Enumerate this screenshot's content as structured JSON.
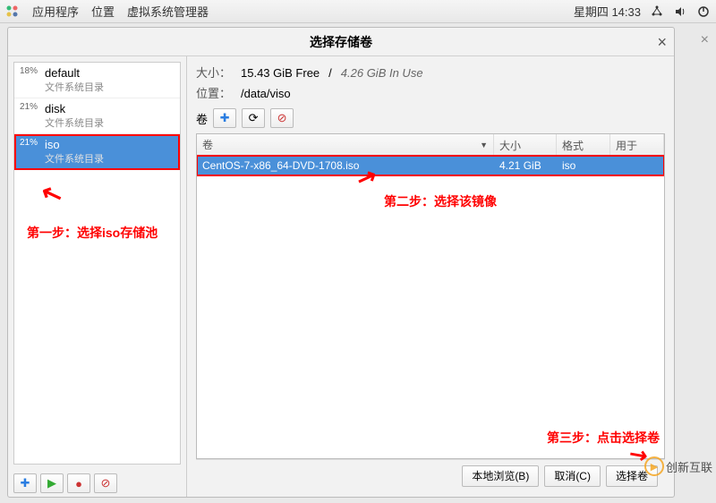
{
  "top_panel": {
    "apps": "应用程序",
    "places": "位置",
    "app_title": "虚拟系统管理器",
    "clock": "星期四 14:33"
  },
  "dialog": {
    "title": "选择存储卷",
    "size_label": "大小：",
    "size_free": "15.43 GiB Free",
    "size_sep": "/",
    "size_inuse": "4.26 GiB In Use",
    "location_label": "位置：",
    "location_value": "/data/viso",
    "vol_label": "卷",
    "head_vol": "卷",
    "head_size": "大小",
    "head_fmt": "格式",
    "head_use": "用于",
    "browse_btn": "本地浏览(B)",
    "cancel_btn": "取消(C)",
    "choose_btn": "选择卷"
  },
  "pools": [
    {
      "pct": "18%",
      "name": "default",
      "sub": "文件系统目录"
    },
    {
      "pct": "21%",
      "name": "disk",
      "sub": "文件系统目录"
    },
    {
      "pct": "21%",
      "name": "iso",
      "sub": "文件系统目录"
    }
  ],
  "volumes": [
    {
      "name": "CentOS-7-x86_64-DVD-1708.iso",
      "size": "4.21 GiB",
      "fmt": "iso",
      "use": ""
    }
  ],
  "annotations": {
    "step1": "第一步：选择iso存储池",
    "step2": "第二步：选择该镜像",
    "step3": "第三步：点击选择卷"
  },
  "watermark": "创新互联"
}
